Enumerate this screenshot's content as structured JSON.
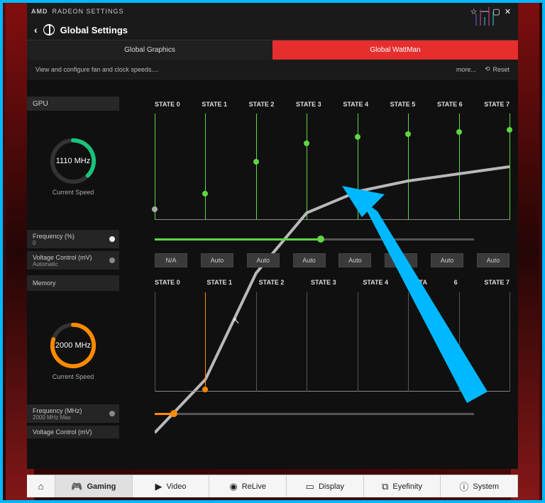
{
  "titlebar": {
    "brand": "AMD",
    "product": "RADEON SETTINGS"
  },
  "header": {
    "title": "Global Settings"
  },
  "tabs": {
    "graphics": "Global Graphics",
    "wattman": "Global WattMan"
  },
  "rowbar": {
    "hint": "View and configure fan and clock speeds....",
    "more": "more...",
    "reset": "Reset"
  },
  "gpu": {
    "label": "GPU",
    "gauge_value": "1110 MHz",
    "gauge_caption": "Current Speed",
    "states": [
      "STATE 0",
      "STATE 1",
      "STATE 2",
      "STATE 3",
      "STATE 4",
      "STATE 5",
      "STATE 6",
      "STATE 7"
    ],
    "auto_buttons": [
      "N/A",
      "Auto",
      "Auto",
      "Auto",
      "Auto",
      "",
      "Auto",
      "Auto"
    ]
  },
  "freq_pct": {
    "label": "Frequency (%)",
    "value": "0"
  },
  "voltage": {
    "label": "Voltage Control (mV)",
    "mode": "Automatic"
  },
  "memory": {
    "label": "Memory",
    "gauge_value": "2000 MHz",
    "gauge_caption": "Current Speed",
    "states": [
      "STATE 0",
      "STATE 1",
      "STATE 2",
      "STATE 3",
      "STATE 4",
      "STA",
      "6",
      "STATE 7"
    ]
  },
  "mem_freq": {
    "label": "Frequency (MHz)",
    "value": "2000 MHz Max"
  },
  "mem_voltage": {
    "label": "Voltage Control (mV)"
  },
  "footer": {
    "home": "⌂",
    "items": [
      {
        "icon": "🎮",
        "label": "Gaming"
      },
      {
        "icon": "▶",
        "label": "Video"
      },
      {
        "icon": "◉",
        "label": "ReLive"
      },
      {
        "icon": "▭",
        "label": "Display"
      },
      {
        "icon": "⧉",
        "label": "Eyefinity"
      },
      {
        "icon": "ⓘ",
        "label": "System"
      }
    ]
  },
  "chart_data": [
    {
      "type": "line",
      "title": "GPU Clock States",
      "categories": [
        "STATE 0",
        "STATE 1",
        "STATE 2",
        "STATE 3",
        "STATE 4",
        "STATE 5",
        "STATE 6",
        "STATE 7"
      ],
      "values": [
        10,
        25,
        55,
        72,
        78,
        81,
        83,
        85
      ],
      "ylim": [
        0,
        100
      ],
      "color": "#5fd642"
    },
    {
      "type": "line",
      "title": "Memory Clock States",
      "categories": [
        "STATE 0",
        "STATE 1",
        "STATE 2",
        "STATE 3",
        "STATE 4",
        "STATE 5",
        "STATE 6",
        "STATE 7"
      ],
      "values": [
        2,
        null,
        null,
        null,
        null,
        null,
        null,
        null
      ],
      "ylim": [
        0,
        100
      ],
      "color": "#ff8a00"
    }
  ]
}
